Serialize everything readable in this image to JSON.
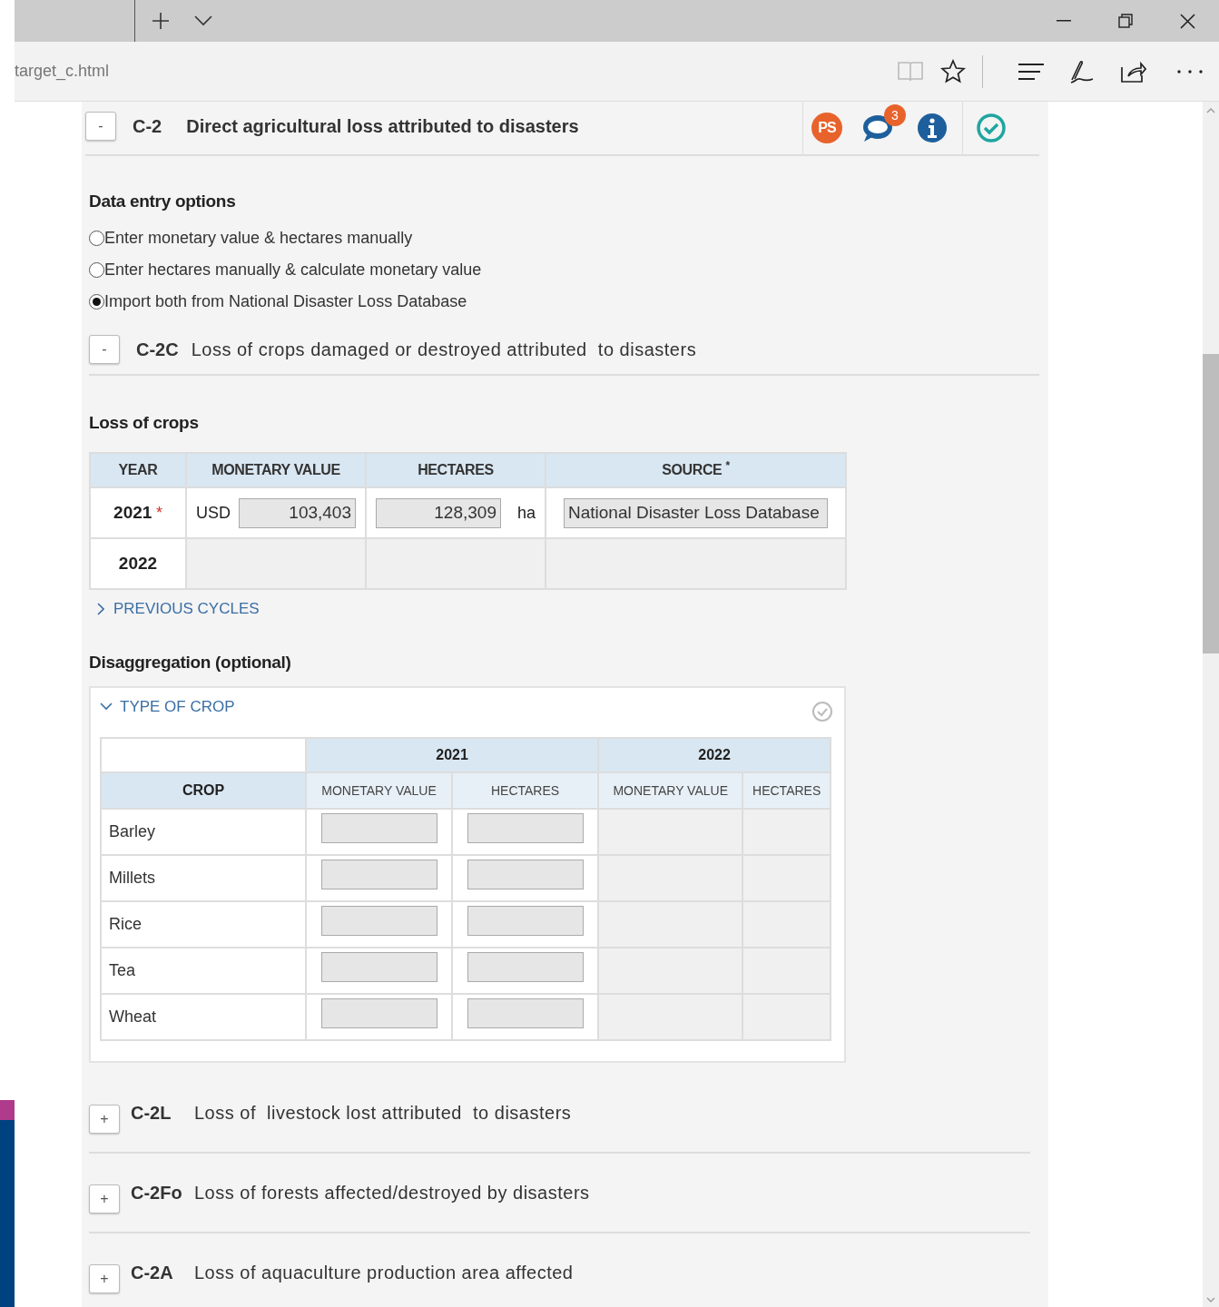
{
  "browser": {
    "url": "target_c.html"
  },
  "section": {
    "toggle": "-",
    "code": "C-2",
    "title": "Direct agricultural loss attributed to disasters",
    "ps_badge": "PS",
    "comment_count": "3"
  },
  "data_entry": {
    "heading": "Data entry options",
    "options": [
      {
        "label": "Enter monetary value & hectares manually",
        "selected": false
      },
      {
        "label": "Enter hectares manually & calculate monetary value",
        "selected": false
      },
      {
        "label": "Import both from National Disaster Loss Database",
        "selected": true
      }
    ]
  },
  "subsection": {
    "toggle": "-",
    "code": "C-2C",
    "title": "Loss of crops damaged or destroyed attributed  to disasters"
  },
  "loss_table": {
    "heading": "Loss of crops",
    "columns": [
      "YEAR",
      "MONETARY VALUE",
      "HECTARES",
      "SOURCE $^{*}$"
    ],
    "rows": [
      {
        "year": "2021",
        "required_mark": "*",
        "disabled": false,
        "currency": "USD",
        "monetary_value": "103,403",
        "hectares": "128,309",
        "unit": "ha",
        "source": "National Disaster Loss Database"
      },
      {
        "year": "2022",
        "disabled": true
      }
    ]
  },
  "previous_cycles": {
    "label": "PREVIOUS CYCLES",
    "expanded": false
  },
  "disaggregation": {
    "heading": "Disaggregation (optional)",
    "panel": {
      "label": "TYPE OF CROP",
      "expanded": true,
      "years": [
        {
          "year": "2021",
          "disabled": false,
          "columns": [
            "MONETARY VALUE",
            "HECTARES"
          ]
        },
        {
          "year": "2022",
          "disabled": true,
          "columns": [
            "MONETARY VALUE",
            "HECTARES"
          ]
        }
      ],
      "crop_column": "CROP",
      "crops": [
        "Barley",
        "Millets",
        "Rice",
        "Tea",
        "Wheat"
      ]
    }
  },
  "collapsed_sections": [
    {
      "toggle": "+",
      "code": "C-2L",
      "title": "Loss of  livestock lost attributed  to disasters"
    },
    {
      "toggle": "+",
      "code": "C-2Fo",
      "title": "Loss of forests affected/destroyed by disasters"
    },
    {
      "toggle": "+",
      "code": "C-2A",
      "title": "Loss of aquaculture production area affected"
    }
  ]
}
